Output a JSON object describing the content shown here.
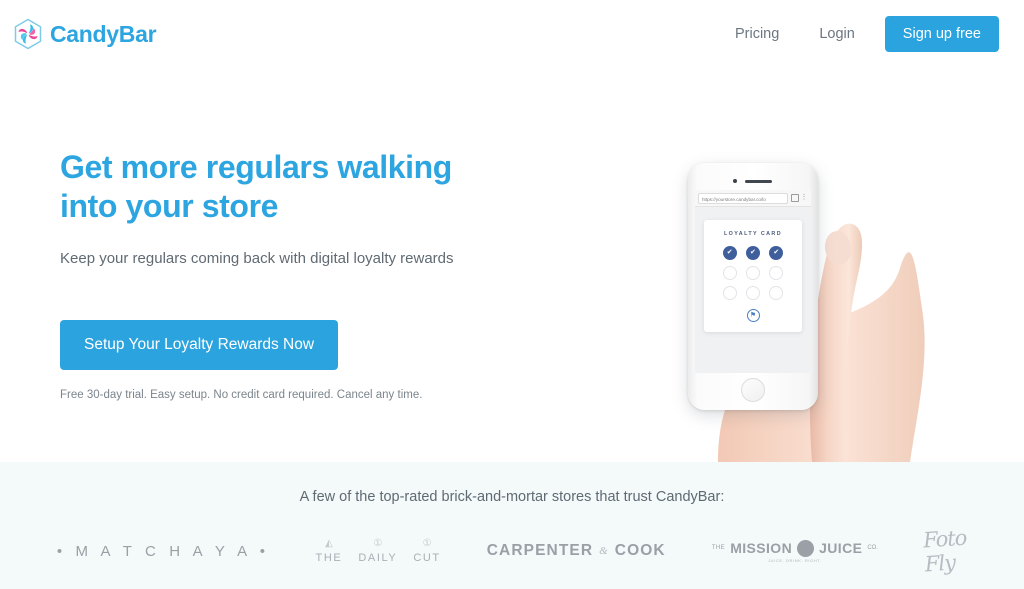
{
  "header": {
    "brand_name": "CandyBar",
    "brand_logo_icon": "candy-pinwheel-hexagon-icon",
    "nav": [
      {
        "label": "Pricing"
      },
      {
        "label": "Login"
      }
    ],
    "signup_label": "Sign up free"
  },
  "hero": {
    "headline_line1": "Get more regulars walking",
    "headline_line2": "into your store",
    "subhead": "Keep your regulars coming back with digital loyalty rewards",
    "cta_label": "Setup Your Loyalty Rewards Now",
    "finetext": "Free 30-day trial. Easy setup. No credit card required. Cancel any time."
  },
  "phone": {
    "url": "https://yourstore.candybar.co/lo",
    "tabs_icon": "browser-tabs-icon",
    "menu_icon": "three-dot-menu-icon",
    "card_title": "LOYALTY CARD",
    "stamps": [
      {
        "state": "filled",
        "glyph": "✔"
      },
      {
        "state": "filled",
        "glyph": "✔"
      },
      {
        "state": "filled",
        "glyph": "✔"
      },
      {
        "state": "empty",
        "glyph": ""
      },
      {
        "state": "empty",
        "glyph": ""
      },
      {
        "state": "empty",
        "glyph": ""
      },
      {
        "state": "empty",
        "glyph": ""
      },
      {
        "state": "empty",
        "glyph": ""
      },
      {
        "state": "empty",
        "glyph": ""
      }
    ],
    "reward_icon": "Ἰ1",
    "reward_glyph": "⚑"
  },
  "trustbar": {
    "title": "A few of the top-rated brick-and-mortar stores that trust CandyBar:",
    "logos": [
      {
        "name": "matchaya",
        "text": "• M A T C H A Y A •"
      },
      {
        "name": "the-daily-cut",
        "words": [
          "THE",
          "DAILY",
          "CUT"
        ],
        "icons": [
          "▲",
          "ⓘ",
          "ⓘ"
        ]
      },
      {
        "name": "carpenter-and-cook",
        "left": "CARPENTER",
        "amp": "&",
        "right": "COOK"
      },
      {
        "name": "the-mission-juice-co",
        "the": "THE",
        "word1": "MISSION",
        "word2": "JUICE",
        "co": "CO.",
        "sub": "JUICE. DRINK. RIGHT."
      },
      {
        "name": "foto-fly",
        "text": "Foto Fly"
      }
    ]
  },
  "colors": {
    "brand_blue": "#2ca5e0",
    "button_blue": "#2ba3de",
    "stamp_navy": "#3f5e9c",
    "trustbar_bg": "#f4f9fa",
    "body_text": "#606a73"
  }
}
